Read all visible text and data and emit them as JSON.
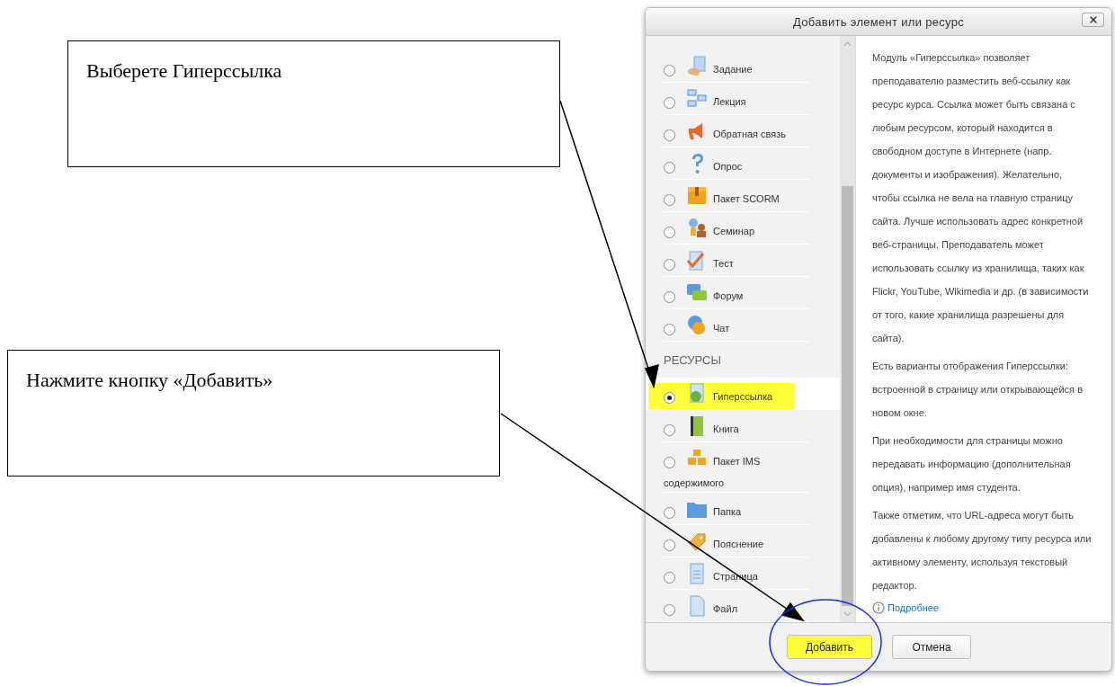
{
  "annotations": [
    {
      "text": "Выберете Гиперссылка"
    },
    {
      "text": "Нажмите кнопку «Добавить»"
    }
  ],
  "dialog": {
    "title": "Добавить элемент или ресурс",
    "sections": [
      {
        "items": [
          {
            "label": "Задание",
            "selected": false,
            "highlighted": false
          },
          {
            "label": "Лекция",
            "selected": false,
            "highlighted": false
          },
          {
            "label": "Обратная связь",
            "selected": false,
            "highlighted": false
          },
          {
            "label": "Опрос",
            "selected": false,
            "highlighted": false
          },
          {
            "label": "Пакет SCORM",
            "selected": false,
            "highlighted": false
          },
          {
            "label": "Семинар",
            "selected": false,
            "highlighted": false
          },
          {
            "label": "Тест",
            "selected": false,
            "highlighted": false
          },
          {
            "label": "Форум",
            "selected": false,
            "highlighted": false
          },
          {
            "label": "Чат",
            "selected": false,
            "highlighted": false
          }
        ]
      },
      {
        "heading": "РЕСУРСЫ",
        "items": [
          {
            "label": "Гиперссылка",
            "selected": true,
            "highlighted": true
          },
          {
            "label": "Книга",
            "selected": false,
            "highlighted": false
          },
          {
            "label": "Пакет IMS содержимого",
            "selected": false,
            "highlighted": false
          },
          {
            "label": "Папка",
            "selected": false,
            "highlighted": false
          },
          {
            "label": "Пояснение",
            "selected": false,
            "highlighted": false
          },
          {
            "label": "Страница",
            "selected": false,
            "highlighted": false
          },
          {
            "label": "Файл",
            "selected": false,
            "highlighted": false
          }
        ]
      }
    ],
    "description": {
      "paragraphs": [
        "Модуль «Гиперссылка» позволяет преподавателю разместить веб-ссылку как ресурс курса. Ссылка может быть связана с любым ресурсом, который находится в свободном доступе в Интернете (напр. документы и изображения). Желательно, чтобы ссылка не вела на главную страницу сайта. Лучше использовать адрес конкретной веб-страницы. Преподаватель может использовать ссылку из хранилища, таких как Flickr, YouTube, Wikimedia и др. (в зависимости от того, какие хранилища разрешены для сайта).",
        "Есть варианты отображения Гиперссылки: встроенной в страницу или открывающейся в новом окне.",
        "При необходимости для страницы можно передавать информацию (дополнительная опция), например имя студента.",
        "Также отметим, что URL-адреса могут быть добавлены к любому другому типу ресурса или активному элементу, используя текстовый редактор."
      ],
      "link": "Подробнее"
    },
    "buttons": [
      {
        "label": "Добавить",
        "highlighted": true
      },
      {
        "label": "Отмена",
        "highlighted": false
      }
    ]
  }
}
